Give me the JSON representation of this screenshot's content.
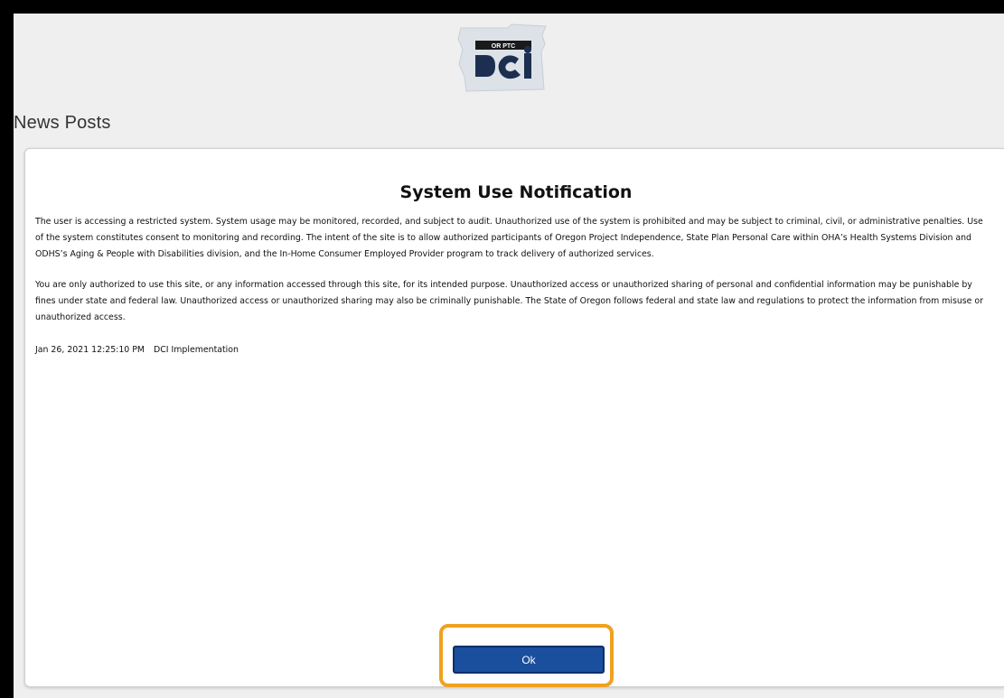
{
  "header": {
    "logo": {
      "icon": "oregon-dci-logo",
      "top_text": "OR PTC",
      "bottom_text": "DCI"
    }
  },
  "page": {
    "title": "News Posts"
  },
  "notification": {
    "title": "System Use Notification",
    "paragraphs": [
      "The user is accessing a restricted system.  System usage may be monitored, recorded, and subject to audit. Unauthorized use of the system is prohibited and may be subject to criminal, civil, or administrative penalties. Use of the system constitutes consent to monitoring and recording. The intent of the site is to allow authorized participants of Oregon Project Independence, State Plan Personal Care within OHA’s Health Systems Division and ODHS’s Aging & People with Disabilities division, and the In-Home Consumer Employed Provider program to track delivery of authorized services.",
      "You are only authorized to use this site, or any information accessed through this site, for its intended purpose. Unauthorized access or unauthorized sharing of personal and confidential information may be punishable by fines under state and federal law. Unauthorized access or unauthorized sharing may also be criminally punishable. The State of Oregon follows federal and state law and regulations to protect the information from misuse or unauthorized access."
    ],
    "timestamp": "Jan 26, 2021 12:25:10 PM",
    "author": "DCI Implementation",
    "ok_label": "Ok"
  },
  "colors": {
    "button": "#1a4f9e",
    "highlight": "#f0a11f",
    "background": "#efefef"
  }
}
